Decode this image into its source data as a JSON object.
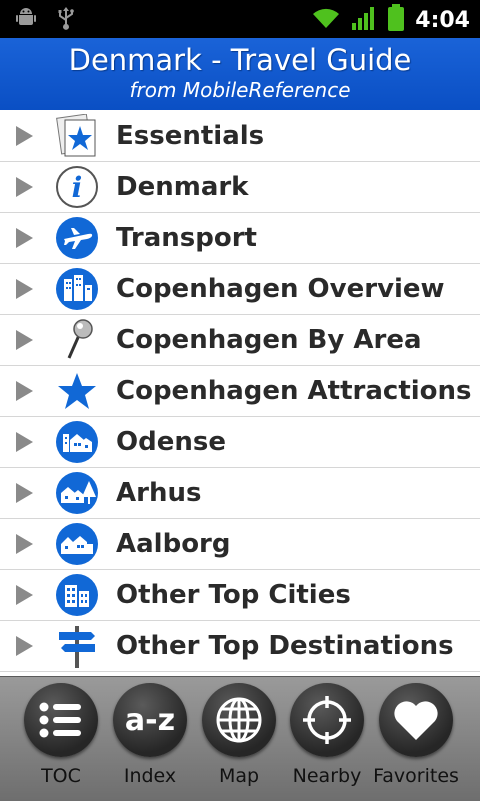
{
  "status_bar": {
    "time": "4:04"
  },
  "header": {
    "title": "Denmark - Travel Guide",
    "subtitle": "from MobileReference"
  },
  "menu": [
    {
      "label": "Essentials",
      "icon": "essentials-star-card-icon"
    },
    {
      "label": "Denmark",
      "icon": "info-icon"
    },
    {
      "label": "Transport",
      "icon": "airplane-icon"
    },
    {
      "label": "Copenhagen Overview",
      "icon": "city-buildings-icon"
    },
    {
      "label": "Copenhagen By Area",
      "icon": "map-pin-icon"
    },
    {
      "label": "Copenhagen Attractions",
      "icon": "star-icon"
    },
    {
      "label": "Odense",
      "icon": "houses-icon"
    },
    {
      "label": "Arhus",
      "icon": "house-tree-icon"
    },
    {
      "label": "Aalborg",
      "icon": "houses-icon"
    },
    {
      "label": "Other Top Cities",
      "icon": "buildings-icon"
    },
    {
      "label": "Other Top Destinations",
      "icon": "signpost-icon"
    }
  ],
  "toolbar": [
    {
      "label": "TOC",
      "icon": "list-icon"
    },
    {
      "label": "Index",
      "icon": "a-z-icon",
      "glyph": "a-z"
    },
    {
      "label": "Map",
      "icon": "globe-icon"
    },
    {
      "label": "Nearby",
      "icon": "crosshair-icon"
    },
    {
      "label": "Favorites",
      "icon": "heart-icon"
    }
  ],
  "colors": {
    "header_blue": "#0a4fc4",
    "icon_blue": "#1168d6"
  }
}
